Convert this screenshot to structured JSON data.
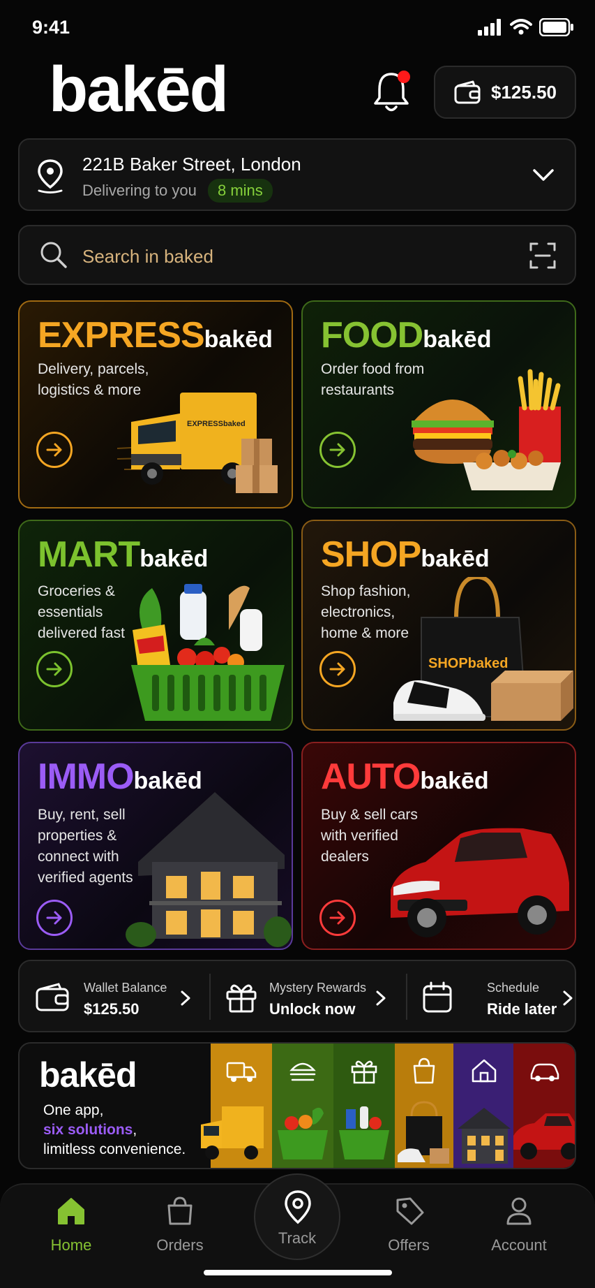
{
  "status_bar": {
    "time": "9:41"
  },
  "header": {
    "logo": "bakēd",
    "wallet_amount": "$125.50"
  },
  "address": {
    "title": "221B Baker Street, London",
    "subtitle": "Delivering to you",
    "eta": "8 mins"
  },
  "search": {
    "placeholder": "Search in baked"
  },
  "services": [
    {
      "title": "EXPRESS",
      "brand": "bakēd",
      "description": [
        "Delivery, parcels,",
        "logistics & more"
      ],
      "accent": "#f5a623",
      "truck_label": "EXPRESSbaked"
    },
    {
      "title": "FOOD",
      "brand": "bakēd",
      "description": [
        "Order food from",
        "restaurants"
      ],
      "accent": "#86c232"
    },
    {
      "title": "MART",
      "brand": "bakēd",
      "description": [
        "Groceries &",
        "essentials",
        "delivered fast"
      ],
      "accent": "#7cc22e"
    },
    {
      "title": "SHOP",
      "brand": "bakēd",
      "description": [
        "Shop fashion,",
        "electronics,",
        "home & more"
      ],
      "accent": "#f5a623",
      "bag_label": "SHOPbaked"
    },
    {
      "title": "IMMO",
      "brand": "bakēd",
      "description": [
        "Buy, rent, sell",
        "properties &",
        "connect with",
        "verified agents"
      ],
      "accent": "#9b5cf6"
    },
    {
      "title": "AUTO",
      "brand": "bakēd",
      "description": [
        "Buy & sell cars",
        "with verified",
        "dealers"
      ],
      "accent": "#ff3b3b"
    }
  ],
  "quick_actions": [
    {
      "small": "Wallet Balance",
      "big": "$125.50",
      "icon": "wallet-icon"
    },
    {
      "small": "Mystery Rewards",
      "big": "Unlock now",
      "icon": "gift-icon"
    },
    {
      "small": "Schedule",
      "big": "Ride later",
      "icon": "calendar-icon"
    }
  ],
  "banner": {
    "logo": "bakēd",
    "line1": "One app,",
    "line2": "six solutions",
    "line2_suffix": ",",
    "line3": "limitless convenience."
  },
  "nav": [
    {
      "label": "Home",
      "icon": "home-icon",
      "active": true
    },
    {
      "label": "Orders",
      "icon": "bag-icon"
    },
    {
      "label": "Track",
      "icon": "location-pin-icon"
    },
    {
      "label": "Offers",
      "icon": "tag-icon"
    },
    {
      "label": "Account",
      "icon": "user-icon"
    }
  ],
  "colors": {
    "accent_green": "#86d13b",
    "accent_orange": "#f5a623",
    "accent_purple": "#9b5cf6",
    "accent_red": "#ff3b3b",
    "background": "#060606"
  }
}
